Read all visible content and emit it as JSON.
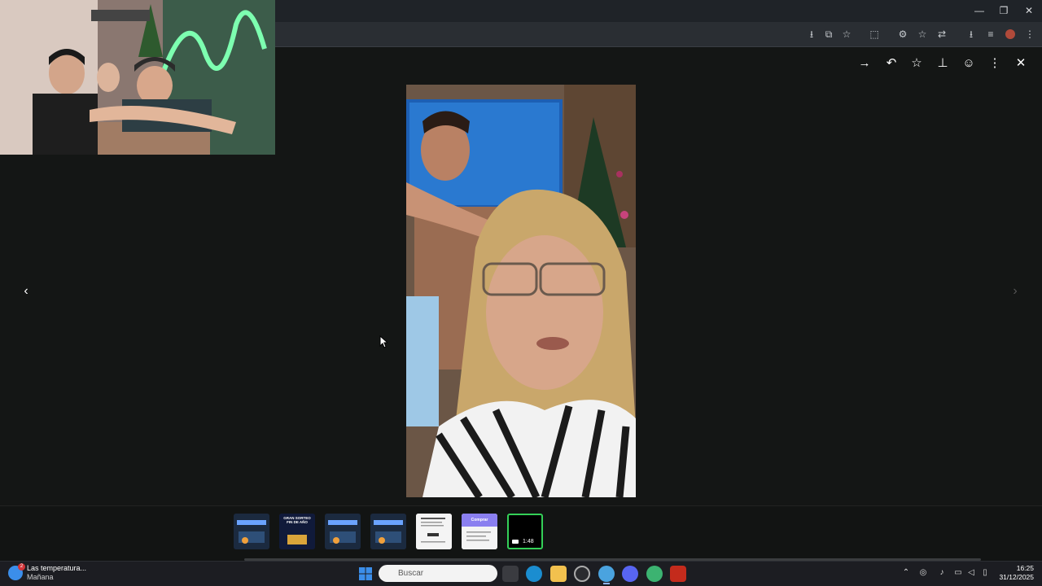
{
  "browser": {
    "window_controls": {
      "minimize": "—",
      "maximize": "❐",
      "close": "✕"
    },
    "toolbar_icons": [
      "download-icon",
      "install-icon",
      "star-icon",
      "extensions-icon",
      "puzzle-icon",
      "bookmark-icon",
      "translate-icon",
      "downloads-icon",
      "media-icon",
      "profile-icon",
      "menu-icon"
    ]
  },
  "viewer": {
    "actions": {
      "forward": "→",
      "reply": "↶",
      "star": "☆",
      "pin": "⊥",
      "emoji": "☺",
      "more": "⋮",
      "close": "✕"
    },
    "nav": {
      "prev": "‹",
      "next": "›"
    }
  },
  "thumbnails": [
    {
      "kind": "dark",
      "icon": "image-icon"
    },
    {
      "kind": "dark",
      "title": "GRAN SORTEO FIN DE AÑO"
    },
    {
      "kind": "dark",
      "icon": "image-icon"
    },
    {
      "kind": "dark",
      "icon": "image-icon"
    },
    {
      "kind": "doc",
      "icon": "document-icon"
    },
    {
      "kind": "doc",
      "title": "Comprar"
    },
    {
      "kind": "video",
      "duration": "1:48",
      "selected": true
    }
  ],
  "taskbar": {
    "weather": {
      "badge": "2",
      "title": "Las temperatura...",
      "subtitle": "Mañana"
    },
    "search_placeholder": "Buscar",
    "clock": {
      "time": "16:25",
      "date": "31/12/2025"
    },
    "colors": {
      "start": "#3b8eea",
      "selection": "#34d058"
    }
  }
}
